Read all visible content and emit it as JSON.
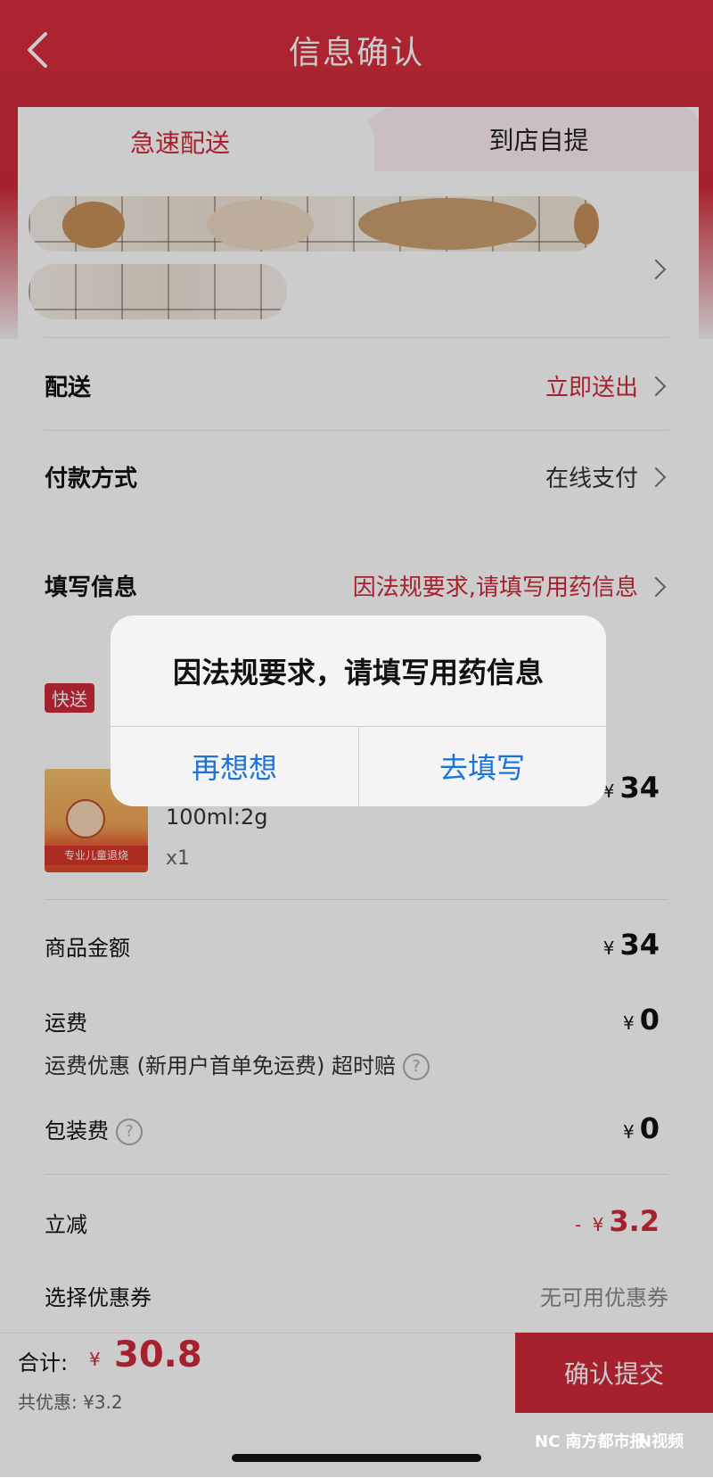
{
  "header": {
    "title": "信息确认"
  },
  "tabs": [
    {
      "label": "急速配送"
    },
    {
      "label": "到店自提"
    }
  ],
  "rows": {
    "delivery": {
      "label": "配送",
      "value": "立即送出"
    },
    "payment": {
      "label": "付款方式",
      "value": "在线支付"
    },
    "fill_info": {
      "label": "填写信息",
      "value": "因法规要求,请填写用药信息"
    }
  },
  "product": {
    "badge": "快送",
    "image_text": "专业儿童退烧",
    "spec": "100ml:2g",
    "qty": "x1",
    "currency": "¥",
    "price": "34"
  },
  "summary": {
    "goods_label": "商品金额",
    "goods_value": "34",
    "shipping_label": "运费",
    "shipping_value": "0",
    "shipping_note": "运费优惠 (新用户首单免运费)  超时赔",
    "packing_label": "包装费",
    "packing_value": "0",
    "discount_label": "立减",
    "discount_prefix": "- ",
    "discount_value": "3.2",
    "coupon_label": "选择优惠券",
    "coupon_value": "无可用优惠券",
    "help_glyph": "?"
  },
  "footer": {
    "total_label": "合计:",
    "currency": "¥",
    "total_value": "30.8",
    "saving": "共优惠:  ¥3.2",
    "submit": "确认提交",
    "watermark1": "NC 南方都市报",
    "watermark2": "N视频"
  },
  "dialog": {
    "message": "因法规要求，请填写用药信息",
    "cancel": "再想想",
    "confirm": "去填写"
  },
  "colors": {
    "accent": "#d02a3a",
    "link": "#1e73d8"
  }
}
